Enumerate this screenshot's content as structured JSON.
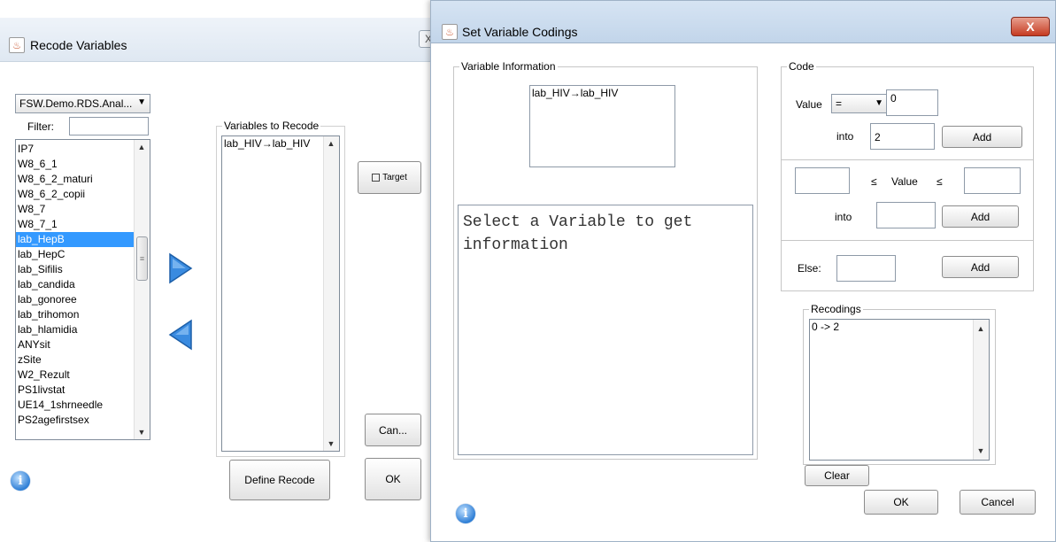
{
  "recode_window": {
    "title": "Recode Variables",
    "dataset_dropdown": "FSW.Demo.RDS.Anal...",
    "filter_label": "Filter:",
    "filter_value": "",
    "variables": [
      "IP7",
      "W8_6_1",
      "W8_6_2_maturi",
      "W8_6_2_copii",
      "W8_7",
      "W8_7_1",
      "lab_HepB",
      "lab_HepC",
      "lab_Sifilis",
      "lab_candida",
      "lab_gonoree",
      "lab_trihomon",
      "lab_hlamidia",
      "ANYsit",
      "zSite",
      "W2_Rezult",
      "PS1livstat",
      "UE14_1shrneedle",
      "PS2agefirstsex"
    ],
    "selected_variable": "lab_HepB",
    "recode_group_title": "Variables to Recode",
    "recode_items": [
      "lab_HIV→lab_HIV"
    ],
    "target_checkbox_label": "Target",
    "cancel_label": "Can...",
    "define_recode_label": "Define Recode",
    "ok_label": "OK",
    "close_glyph": "X"
  },
  "codings_dialog": {
    "title": "Set Variable Codings",
    "close_glyph": "X",
    "var_info_title": "Variable Information",
    "var_info_item": "lab_HIV→lab_HIV",
    "info_text": "Select a Variable to get information",
    "code_title": "Code",
    "value_label": "Value",
    "operator": "=",
    "value_input": "0",
    "into_label": "into",
    "into_value": "2",
    "add_label": "Add",
    "leq_symbol": "≤",
    "range_value_label": "Value",
    "range_low": "",
    "range_high": "",
    "range_into_label": "into",
    "range_into_value": "",
    "else_label": "Else:",
    "else_value": "",
    "recodings_title": "Recodings",
    "recodings": [
      "0 -> 2"
    ],
    "clear_label": "Clear",
    "ok_label": "OK",
    "cancel_label": "Cancel"
  }
}
